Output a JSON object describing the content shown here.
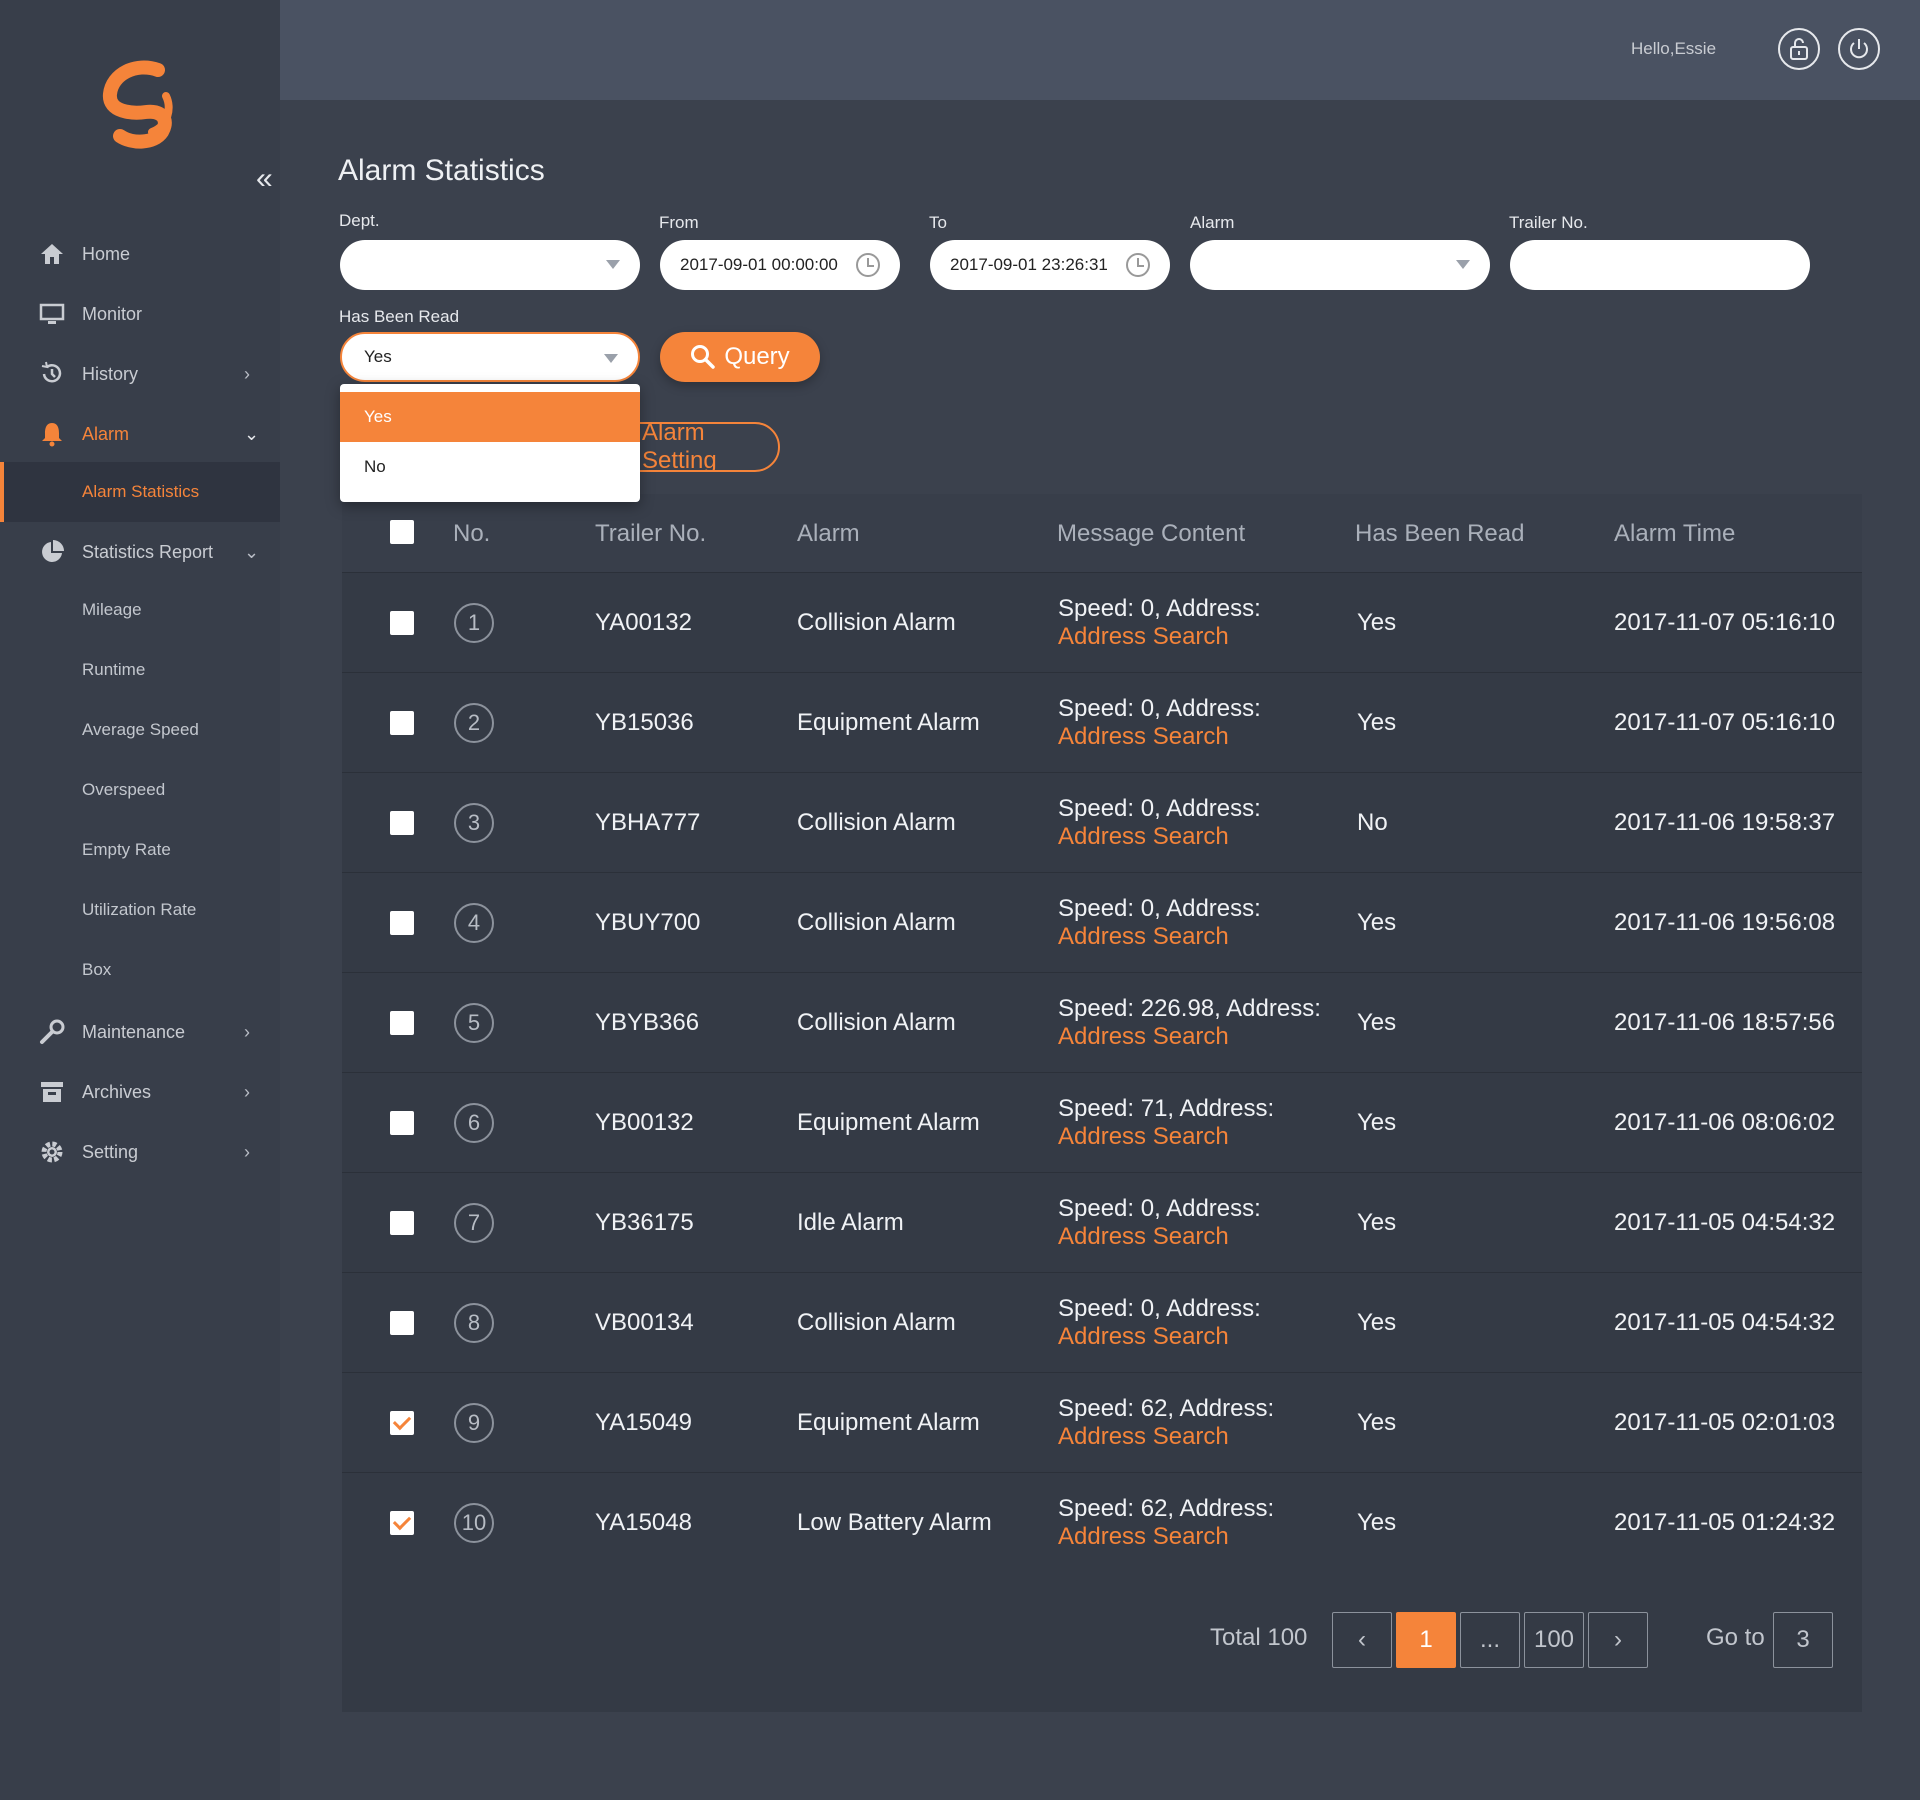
{
  "header": {
    "greeting": "Hello,Essie",
    "lock_icon": "lock-icon",
    "power_icon": "power-icon"
  },
  "sidebar": {
    "collapse_glyph": "«",
    "items": [
      {
        "label": "Home",
        "icon": "home-icon"
      },
      {
        "label": "Monitor",
        "icon": "monitor-icon"
      },
      {
        "label": "History",
        "icon": "history-icon"
      },
      {
        "label": "Alarm",
        "icon": "bell-icon"
      },
      {
        "label": "Alarm Statistics"
      },
      {
        "label": "Statistics Report",
        "icon": "pie-chart-icon"
      },
      {
        "label": "Mileage"
      },
      {
        "label": "Runtime"
      },
      {
        "label": "Average Speed"
      },
      {
        "label": "Overspeed"
      },
      {
        "label": "Empty Rate"
      },
      {
        "label": "Utilization Rate"
      },
      {
        "label": "Box"
      },
      {
        "label": "Maintenance",
        "icon": "wrench-icon"
      },
      {
        "label": "Archives",
        "icon": "archive-icon"
      },
      {
        "label": "Setting",
        "icon": "gear-icon"
      }
    ]
  },
  "page": {
    "title": "Alarm Statistics"
  },
  "filters": {
    "dept_label": "Dept.",
    "dept_value": "",
    "from_label": "From",
    "from_value": "2017-09-01 00:00:00",
    "to_label": "To",
    "to_value": "2017-09-01 23:26:31",
    "alarm_label": "Alarm",
    "alarm_value": "",
    "trailer_label": "Trailer No.",
    "trailer_value": "",
    "read_label": "Has Been Read",
    "read_value": "Yes",
    "read_options": [
      "Yes",
      "No"
    ],
    "query_label": "Query",
    "setting_label": "Alarm Setting"
  },
  "table": {
    "headers": [
      "No.",
      "Trailer No.",
      "Alarm",
      "Message Content",
      "Has Been Read",
      "Alarm Time"
    ],
    "rows": [
      {
        "no": "1",
        "trailer": "YA00132",
        "alarm": "Collision Alarm",
        "msg": "Speed: 0, Address:",
        "link": "Address Search",
        "read": "Yes",
        "time": "2017-11-07 05:16:10",
        "checked": false
      },
      {
        "no": "2",
        "trailer": "YB15036",
        "alarm": "Equipment Alarm",
        "msg": "Speed: 0, Address:",
        "link": "Address Search",
        "read": "Yes",
        "time": "2017-11-07 05:16:10",
        "checked": false
      },
      {
        "no": "3",
        "trailer": "YBHA777",
        "alarm": "Collision Alarm",
        "msg": "Speed: 0, Address:",
        "link": "Address Search",
        "read": "No",
        "time": "2017-11-06 19:58:37",
        "checked": false
      },
      {
        "no": "4",
        "trailer": "YBUY700",
        "alarm": "Collision Alarm",
        "msg": "Speed: 0, Address:",
        "link": "Address Search",
        "read": "Yes",
        "time": "2017-11-06 19:56:08",
        "checked": false
      },
      {
        "no": "5",
        "trailer": "YBYB366",
        "alarm": "Collision Alarm",
        "msg": "Speed: 226.98, Address:",
        "link": "Address Search",
        "read": "Yes",
        "time": "2017-11-06 18:57:56",
        "checked": false
      },
      {
        "no": "6",
        "trailer": "YB00132",
        "alarm": "Equipment Alarm",
        "msg": "Speed: 71, Address:",
        "link": "Address Search",
        "read": "Yes",
        "time": "2017-11-06 08:06:02",
        "checked": false
      },
      {
        "no": "7",
        "trailer": "YB36175",
        "alarm": "Idle Alarm",
        "msg": "Speed: 0, Address:",
        "link": "Address Search",
        "read": "Yes",
        "time": "2017-11-05 04:54:32",
        "checked": false
      },
      {
        "no": "8",
        "trailer": "VB00134",
        "alarm": "Collision Alarm",
        "msg": "Speed: 0, Address:",
        "link": "Address Search",
        "read": "Yes",
        "time": "2017-11-05 04:54:32",
        "checked": false
      },
      {
        "no": "9",
        "trailer": "YA15049",
        "alarm": "Equipment Alarm",
        "msg": "Speed: 62, Address:",
        "link": "Address Search",
        "read": "Yes",
        "time": "2017-11-05 02:01:03",
        "checked": true
      },
      {
        "no": "10",
        "trailer": "YA15048",
        "alarm": "Low Battery Alarm",
        "msg": "Speed: 62, Address:",
        "link": "Address Search",
        "read": "Yes",
        "time": "2017-11-05 01:24:32",
        "checked": true
      }
    ]
  },
  "pagination": {
    "total": "Total 100",
    "prev": "‹",
    "current": "1",
    "ellipsis": "...",
    "last": "100",
    "next": "›",
    "goto_label": "Go to",
    "goto_value": "3"
  },
  "colors": {
    "accent": "#f5843a",
    "sidebar_bg": "#383e4a",
    "header_bg": "#4a5262",
    "content_bg": "#3b414d"
  }
}
